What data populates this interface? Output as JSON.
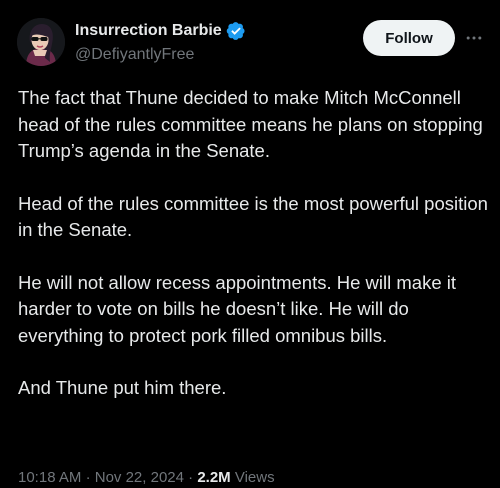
{
  "author": {
    "display_name": "Insurrection Barbie",
    "handle": "@DefiyantlyFree",
    "verified_color": "#1d9bf0"
  },
  "actions": {
    "follow_label": "Follow",
    "more_icon": "more-horizontal-icon"
  },
  "tweet": {
    "paragraphs": [
      "The fact that Thune decided to make Mitch McConnell head of the rules committee means he plans on stopping Trump’s agenda in the Senate.",
      "Head of the rules committee is the most powerful position in the Senate.",
      "He will not allow recess appointments. He will make it harder to vote on bills he doesn’t like. He will do everything to protect pork filled omnibus bills.",
      "And Thune put him there."
    ]
  },
  "meta": {
    "time": "10:18 AM",
    "separator": "·",
    "date": "Nov 22, 2024",
    "views_count": "2.2M",
    "views_label": "Views"
  },
  "colors": {
    "background": "#000000",
    "text": "#e7e9ea",
    "secondary": "#71767b",
    "button_bg": "#eff3f4"
  }
}
